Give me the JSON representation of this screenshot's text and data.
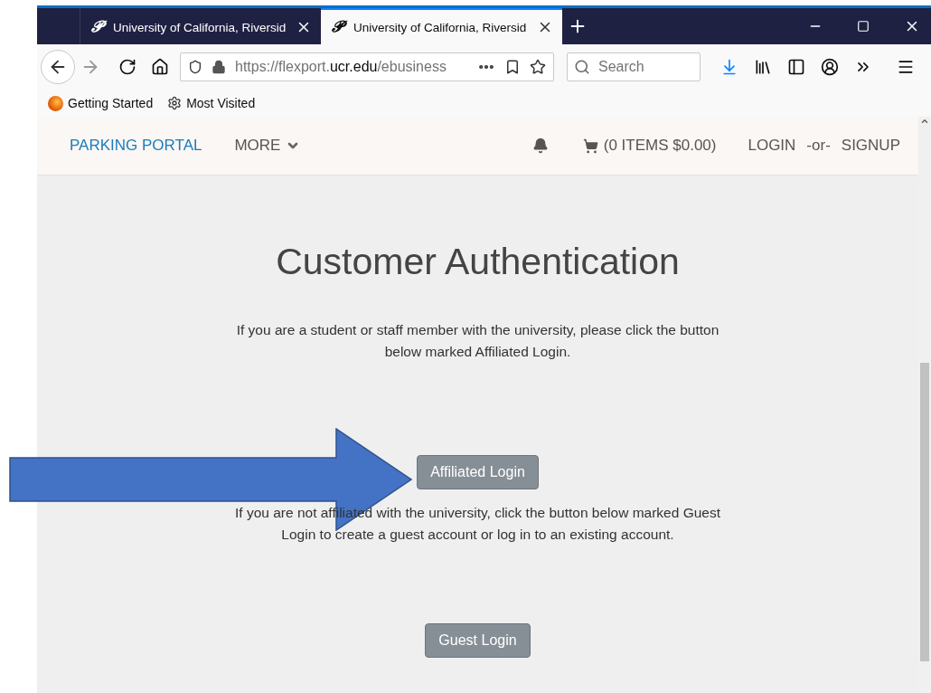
{
  "tabs": [
    {
      "favicon": "𝓟",
      "title": "University of California, Riversid",
      "selected": false
    },
    {
      "favicon": "𝓟",
      "title": "University of California, Riversid",
      "selected": true
    }
  ],
  "address_bar": {
    "scheme_host": "https://flexport.",
    "domain": "ucr.edu",
    "path": "/ebusiness"
  },
  "search": {
    "placeholder": "Search"
  },
  "bookmarks": [
    {
      "kind": "firefox",
      "label": "Getting Started"
    },
    {
      "kind": "gear",
      "label": "Most Visited"
    }
  ],
  "site_nav": {
    "brand": "PARKING PORTAL",
    "more": "MORE",
    "cart": "(0 ITEMS $0.00)",
    "login": "LOGIN",
    "separator": "-or-",
    "signup": "SIGNUP"
  },
  "content": {
    "heading": "Customer Authentication",
    "affiliated_text": "If you are a student or staff member with the university, please click the button below marked Affiliated Login.",
    "affiliated_button": "Affiliated Login",
    "guest_text": "If you are not affiliated with the university, click the button below marked Guest Login to create a guest account or log in to an existing account.",
    "guest_button": "Guest Login"
  }
}
